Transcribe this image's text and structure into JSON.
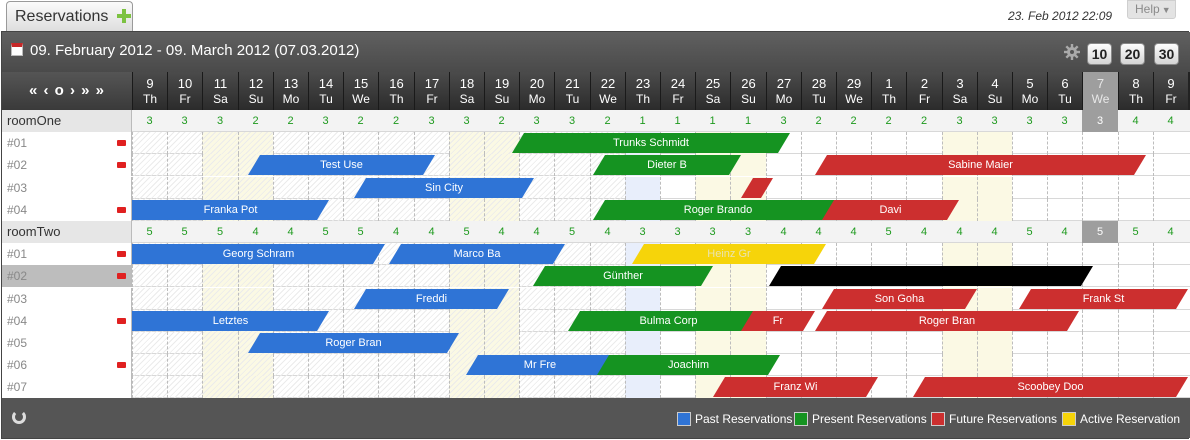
{
  "app": {
    "tab_title": "Reservations",
    "clock": "23. Feb 2012 22:09",
    "help_label": "Help"
  },
  "header": {
    "range": "09. February 2012 - 09. March 2012 (07.03.2012)",
    "zoom_options": [
      "10",
      "20",
      "30"
    ]
  },
  "nav": {
    "label": "« ‹ o › » »"
  },
  "colors": {
    "past": "#2f74d6",
    "present": "#159321",
    "future": "#cc2f2f",
    "active": "#f6d40a",
    "selected": "#000000"
  },
  "days": [
    {
      "n": "9",
      "w": "Th"
    },
    {
      "n": "10",
      "w": "Fr"
    },
    {
      "n": "11",
      "w": "Sa"
    },
    {
      "n": "12",
      "w": "Su"
    },
    {
      "n": "13",
      "w": "Mo"
    },
    {
      "n": "14",
      "w": "Tu"
    },
    {
      "n": "15",
      "w": "We"
    },
    {
      "n": "16",
      "w": "Th"
    },
    {
      "n": "17",
      "w": "Fr"
    },
    {
      "n": "18",
      "w": "Sa"
    },
    {
      "n": "19",
      "w": "Su"
    },
    {
      "n": "20",
      "w": "Mo"
    },
    {
      "n": "21",
      "w": "Tu"
    },
    {
      "n": "22",
      "w": "We"
    },
    {
      "n": "23",
      "w": "Th"
    },
    {
      "n": "24",
      "w": "Fr"
    },
    {
      "n": "25",
      "w": "Sa"
    },
    {
      "n": "26",
      "w": "Su"
    },
    {
      "n": "27",
      "w": "Mo"
    },
    {
      "n": "28",
      "w": "Tu"
    },
    {
      "n": "29",
      "w": "We"
    },
    {
      "n": "1",
      "w": "Th"
    },
    {
      "n": "2",
      "w": "Fr"
    },
    {
      "n": "3",
      "w": "Sa"
    },
    {
      "n": "4",
      "w": "Su"
    },
    {
      "n": "5",
      "w": "Mo"
    },
    {
      "n": "6",
      "w": "Tu"
    },
    {
      "n": "7",
      "w": "We"
    },
    {
      "n": "8",
      "w": "Th"
    },
    {
      "n": "9",
      "w": "Fr"
    }
  ],
  "today_index": 27,
  "rooms": [
    {
      "name": "roomOne",
      "counts": [
        "3",
        "3",
        "3",
        "2",
        "2",
        "3",
        "2",
        "2",
        "3",
        "3",
        "2",
        "3",
        "3",
        "2",
        "1",
        "1",
        "1",
        "1",
        "3",
        "2",
        "2",
        "2",
        "2",
        "3",
        "3",
        "3",
        "3",
        "3",
        "4",
        "4"
      ],
      "units": [
        {
          "label": "#01",
          "flag": true,
          "bars": [
            {
              "text": "Trunks Schmidt",
              "status": "present"
            }
          ]
        },
        {
          "label": "#02",
          "flag": true,
          "bars": [
            {
              "text": "Test Use",
              "status": "past"
            },
            {
              "text": "Dieter B",
              "status": "present"
            },
            {
              "text": "Sabine Maier",
              "status": "future"
            }
          ]
        },
        {
          "label": "#03",
          "flag": false,
          "bars": [
            {
              "text": "Sin City",
              "status": "past"
            },
            {
              "text": "",
              "status": "future"
            }
          ]
        },
        {
          "label": "#04",
          "flag": true,
          "bars": [
            {
              "text": "Franka Pot",
              "status": "past"
            },
            {
              "text": "Roger Brando",
              "status": "present"
            },
            {
              "text": "Davi",
              "status": "future"
            }
          ]
        }
      ]
    },
    {
      "name": "roomTwo",
      "counts": [
        "5",
        "5",
        "5",
        "4",
        "4",
        "5",
        "5",
        "4",
        "4",
        "5",
        "4",
        "4",
        "5",
        "4",
        "3",
        "3",
        "3",
        "3",
        "4",
        "4",
        "4",
        "5",
        "4",
        "4",
        "4",
        "5",
        "4",
        "5",
        "5",
        "4"
      ],
      "units": [
        {
          "label": "#01",
          "flag": true,
          "bars": [
            {
              "text": "Georg Schram",
              "status": "past"
            },
            {
              "text": "Marco Ba",
              "status": "past"
            },
            {
              "text": "Heinz Gr",
              "status": "active"
            }
          ]
        },
        {
          "label": "#02",
          "flag": true,
          "selected": true,
          "bars": [
            {
              "text": "Günther",
              "status": "present"
            },
            {
              "text": "",
              "status": "selected"
            }
          ]
        },
        {
          "label": "#03",
          "flag": false,
          "bars": [
            {
              "text": "Freddi",
              "status": "past"
            },
            {
              "text": "Son Goha",
              "status": "future"
            },
            {
              "text": "Frank St",
              "status": "future"
            }
          ]
        },
        {
          "label": "#04",
          "flag": true,
          "bars": [
            {
              "text": "Letztes",
              "status": "past"
            },
            {
              "text": "Bulma Corp",
              "status": "present"
            },
            {
              "text": "Fr",
              "status": "future"
            },
            {
              "text": "Roger Bran",
              "status": "future"
            }
          ]
        },
        {
          "label": "#05",
          "flag": false,
          "bars": [
            {
              "text": "Roger Bran",
              "status": "past"
            }
          ]
        },
        {
          "label": "#06",
          "flag": true,
          "bars": [
            {
              "text": "Mr Fre",
              "status": "past"
            },
            {
              "text": "Joachim",
              "status": "present"
            }
          ]
        },
        {
          "label": "#07",
          "flag": false,
          "bars": [
            {
              "text": "Franz Wi",
              "status": "future"
            },
            {
              "text": "Scoobey Doo",
              "status": "future"
            }
          ]
        }
      ]
    }
  ],
  "legend": [
    {
      "label": "Past Reservations",
      "status": "past"
    },
    {
      "label": "Present Reservations",
      "status": "present"
    },
    {
      "label": "Future Reservations",
      "status": "future"
    },
    {
      "label": "Active Reservation",
      "status": "active"
    }
  ]
}
